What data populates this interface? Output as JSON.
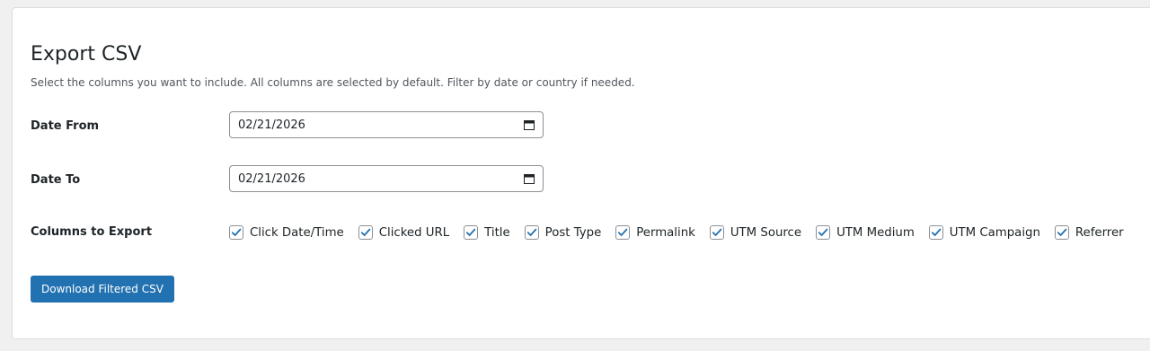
{
  "page": {
    "title": "Export CSV",
    "description": "Select the columns you want to include. All columns are selected by default. Filter by date or country if needed."
  },
  "fields": {
    "date_from": {
      "label": "Date From",
      "value": "02/21/2026"
    },
    "date_to": {
      "label": "Date To",
      "value": "02/21/2026"
    },
    "columns_label": "Columns to Export"
  },
  "columns": [
    {
      "label": "Click Date/Time",
      "checked": true
    },
    {
      "label": "Clicked URL",
      "checked": true
    },
    {
      "label": "Title",
      "checked": true
    },
    {
      "label": "Post Type",
      "checked": true
    },
    {
      "label": "Permalink",
      "checked": true
    },
    {
      "label": "UTM Source",
      "checked": true
    },
    {
      "label": "UTM Medium",
      "checked": true
    },
    {
      "label": "UTM Campaign",
      "checked": true
    },
    {
      "label": "Referrer",
      "checked": true
    }
  ],
  "actions": {
    "download_label": "Download Filtered CSV"
  },
  "colors": {
    "accent": "#2271b1",
    "background": "#f0f0f1",
    "panel": "#ffffff"
  },
  "icons": {
    "calendar": "calendar-icon",
    "checkmark": "checkmark-icon"
  }
}
